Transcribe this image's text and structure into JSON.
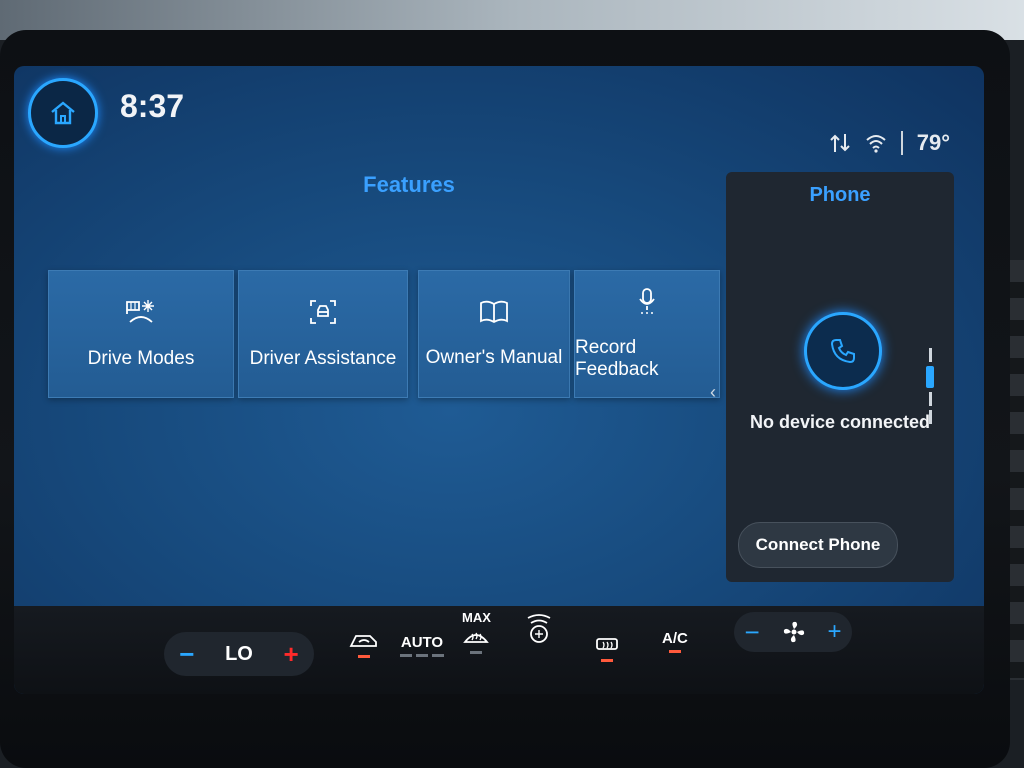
{
  "header": {
    "time": "8:37",
    "temperature": "79°"
  },
  "features": {
    "title": "Features",
    "tiles": [
      {
        "label": "Drive Modes",
        "icon": "drive-modes-icon"
      },
      {
        "label": "Driver Assistance",
        "icon": "driver-assistance-icon"
      },
      {
        "label": "Owner's Manual",
        "icon": "manual-book-icon"
      },
      {
        "label": "Record Feedback",
        "icon": "microphone-icon"
      }
    ]
  },
  "phone": {
    "title": "Phone",
    "status": "No device connected",
    "connect_label": "Connect Phone"
  },
  "climate": {
    "temp_setting": "LO",
    "auto_label": "AUTO",
    "max_label": "MAX",
    "ac_label": "A/C"
  },
  "colors": {
    "accent": "#2aa7ff",
    "title_blue": "#3aa0ff",
    "plus_red": "#ff2a2a",
    "indicator_on": "#ff5a3c"
  }
}
